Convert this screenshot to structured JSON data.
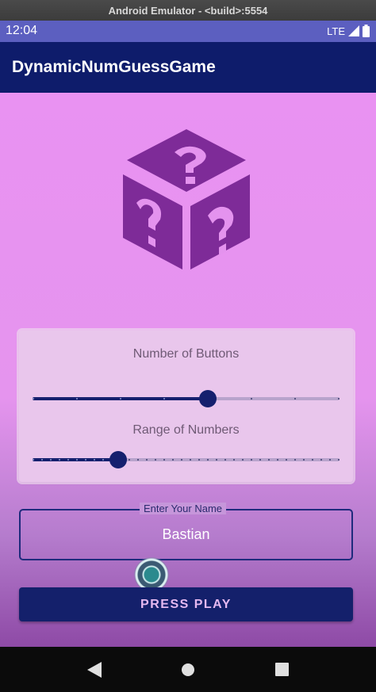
{
  "window": {
    "title": "Android Emulator - <build>:5554"
  },
  "status_bar": {
    "time": "12:04",
    "network": "LTE"
  },
  "app_bar": {
    "title": "DynamicNumGuessGame"
  },
  "logo": {
    "icon": "question-dice-icon",
    "color": "#7e2b98"
  },
  "settings_card": {
    "buttons_slider": {
      "label": "Number of Buttons",
      "steps": 7,
      "value_fraction": 0.571
    },
    "range_slider": {
      "label": "Range of Numbers",
      "steps": 35,
      "value_fraction": 0.278
    }
  },
  "name_field": {
    "label": "Enter Your Name",
    "value": "Bastian"
  },
  "play_button": {
    "label": "PRESS PLAY"
  },
  "colors": {
    "primary_dark": "#0e1c6b",
    "status_bar": "#5c5fc0",
    "gradient_top": "#e992f2",
    "gradient_bottom": "#8e4aa6"
  },
  "nav_bar": {
    "back": "back-icon",
    "home": "home-icon",
    "recents": "recents-icon"
  }
}
